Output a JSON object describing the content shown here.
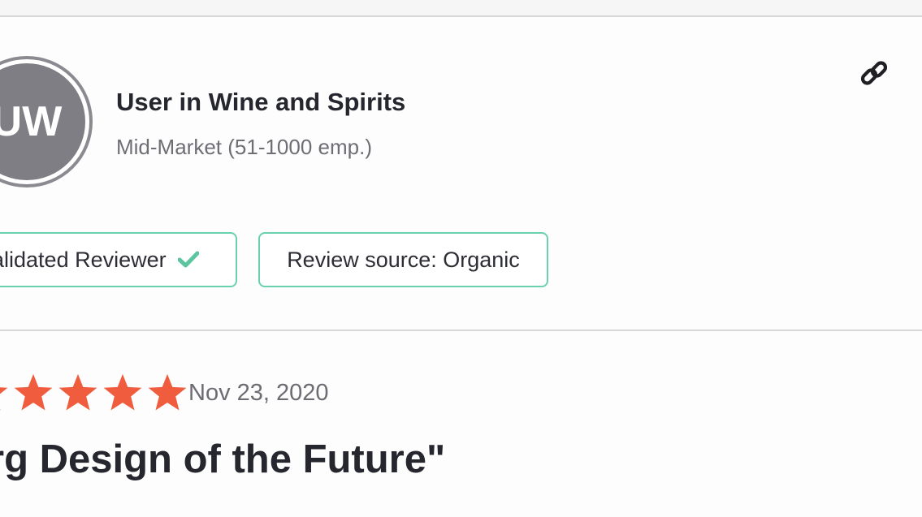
{
  "reviewer": {
    "avatar_initials": "UW",
    "name": "User in Wine and Spirits",
    "segment": "Mid-Market (51-1000 emp.)"
  },
  "badges": {
    "validated": "alidated Reviewer",
    "source": "Review source: Organic"
  },
  "review": {
    "rating": 5,
    "rating_max": 5,
    "date": "Nov 23, 2020",
    "title": "rg Design of the Future\""
  },
  "colors": {
    "star": "#f05c3e",
    "badge_border": "#6ad1ad",
    "check": "#5cc59f",
    "avatar": "#7f7e84"
  },
  "icons": {
    "permalink": "link-icon",
    "verified": "check-icon",
    "rating": "star-icon"
  }
}
